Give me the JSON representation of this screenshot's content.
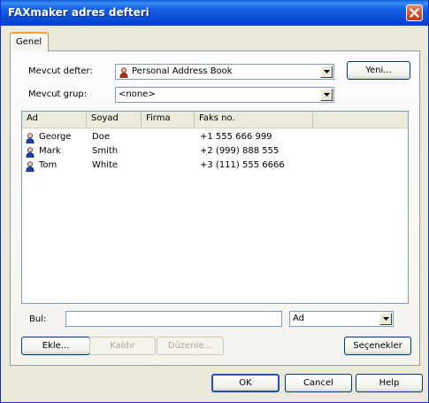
{
  "window": {
    "title": "FAXmaker adres defteri"
  },
  "tabs": [
    {
      "label": "Genel"
    }
  ],
  "current_book": {
    "label": "Mevcut defter:",
    "value": "Personal Address Book"
  },
  "current_group": {
    "label": "Mevcut grup:",
    "value": "<none>"
  },
  "buttons": {
    "new": "Yeni...",
    "add": "Ekle...",
    "remove": "Kaldır",
    "edit": "Düzenle...",
    "options": "Seçenekler",
    "ok": "OK",
    "cancel": "Cancel",
    "help": "Help"
  },
  "list": {
    "columns": [
      "Ad",
      "Soyad",
      "Firma",
      "Faks no."
    ],
    "rows": [
      {
        "first": "George",
        "last": "Doe",
        "company": "",
        "fax": "+1 555 666 999"
      },
      {
        "first": "Mark",
        "last": "Smith",
        "company": "",
        "fax": "+2 (999) 888 555"
      },
      {
        "first": "Tom",
        "last": "White",
        "company": "",
        "fax": "+3 (111) 555 6666"
      }
    ]
  },
  "find": {
    "label": "Bul:",
    "value": "",
    "field": "Ad"
  },
  "icons": {
    "close": "close-icon",
    "contact": "person-icon",
    "book": "address-book-icon",
    "dropdown": "chevron-down-icon"
  },
  "colors": {
    "title_bar": "#0a4fd4",
    "close_button": "#d2522c",
    "tab_accent": "#f2a23a"
  }
}
